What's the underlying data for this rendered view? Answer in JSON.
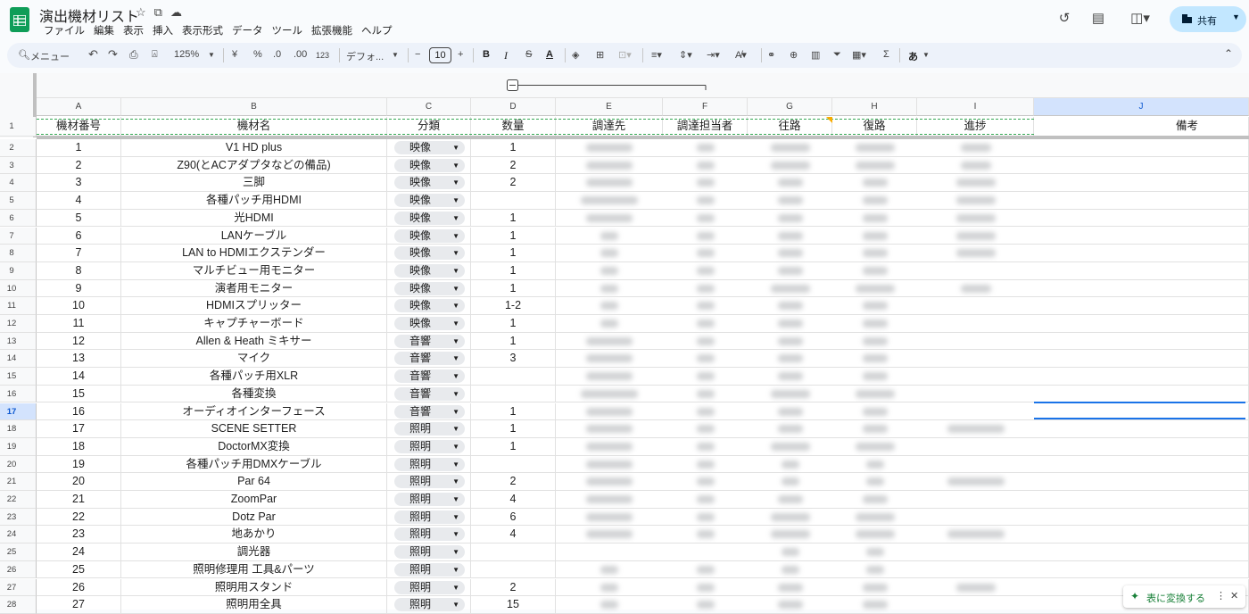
{
  "app": {
    "title": "演出機材リスト",
    "menu": [
      "ファイル",
      "編集",
      "表示",
      "挿入",
      "表示形式",
      "データ",
      "ツール",
      "拡張機能",
      "ヘルプ"
    ],
    "share_label": "共有"
  },
  "toolbar": {
    "search_label": "メニュー",
    "zoom": "125%",
    "currency": "¥",
    "percent": "%",
    "dec_decrease": ".0",
    "dec_increase": ".00",
    "number_format": "123",
    "font": "デフォ...",
    "font_size": "10",
    "minus": "−",
    "plus": "+",
    "bold": "B",
    "italic": "I",
    "strike": "S",
    "text_color": "A",
    "input_tool": "あ"
  },
  "columns": [
    {
      "letter": "A",
      "header": "機材番号"
    },
    {
      "letter": "B",
      "header": "機材名"
    },
    {
      "letter": "C",
      "header": "分類"
    },
    {
      "letter": "D",
      "header": "数量"
    },
    {
      "letter": "E",
      "header": "調達先"
    },
    {
      "letter": "F",
      "header": "調達担当者"
    },
    {
      "letter": "G",
      "header": "往路"
    },
    {
      "letter": "H",
      "header": "復路"
    },
    {
      "letter": "I",
      "header": "進捗"
    },
    {
      "letter": "J",
      "header": "備考"
    }
  ],
  "rows": [
    {
      "n": "2",
      "id": "1",
      "name": "V1 HD plus",
      "cat": "映像",
      "qty": "1"
    },
    {
      "n": "3",
      "id": "2",
      "name": "Z90(とACアダプタなどの備品)",
      "cat": "映像",
      "qty": "2"
    },
    {
      "n": "4",
      "id": "3",
      "name": "三脚",
      "cat": "映像",
      "qty": "2"
    },
    {
      "n": "5",
      "id": "4",
      "name": "各種パッチ用HDMI",
      "cat": "映像",
      "qty": ""
    },
    {
      "n": "6",
      "id": "5",
      "name": "光HDMI",
      "cat": "映像",
      "qty": "1"
    },
    {
      "n": "7",
      "id": "6",
      "name": "LANケーブル",
      "cat": "映像",
      "qty": "1"
    },
    {
      "n": "8",
      "id": "7",
      "name": "LAN to HDMIエクステンダー",
      "cat": "映像",
      "qty": "1"
    },
    {
      "n": "9",
      "id": "8",
      "name": "マルチビュー用モニター",
      "cat": "映像",
      "qty": "1"
    },
    {
      "n": "10",
      "id": "9",
      "name": "演者用モニター",
      "cat": "映像",
      "qty": "1"
    },
    {
      "n": "11",
      "id": "10",
      "name": "HDMIスプリッター",
      "cat": "映像",
      "qty": "1-2"
    },
    {
      "n": "12",
      "id": "11",
      "name": "キャプチャーボード",
      "cat": "映像",
      "qty": "1"
    },
    {
      "n": "13",
      "id": "12",
      "name": "Allen & Heath ミキサー",
      "cat": "音響",
      "qty": "1"
    },
    {
      "n": "14",
      "id": "13",
      "name": "マイク",
      "cat": "音響",
      "qty": "3"
    },
    {
      "n": "15",
      "id": "14",
      "name": "各種パッチ用XLR",
      "cat": "音響",
      "qty": ""
    },
    {
      "n": "16",
      "id": "15",
      "name": "各種変換",
      "cat": "音響",
      "qty": ""
    },
    {
      "n": "17",
      "id": "16",
      "name": "オーディオインターフェース",
      "cat": "音響",
      "qty": "1"
    },
    {
      "n": "18",
      "id": "17",
      "name": "SCENE SETTER",
      "cat": "照明",
      "qty": "1"
    },
    {
      "n": "19",
      "id": "18",
      "name": "DoctorMX変換",
      "cat": "照明",
      "qty": "1"
    },
    {
      "n": "20",
      "id": "19",
      "name": "各種パッチ用DMXケーブル",
      "cat": "照明",
      "qty": ""
    },
    {
      "n": "21",
      "id": "20",
      "name": "Par 64",
      "cat": "照明",
      "qty": "2"
    },
    {
      "n": "22",
      "id": "21",
      "name": "ZoomPar",
      "cat": "照明",
      "qty": "4"
    },
    {
      "n": "23",
      "id": "22",
      "name": "Dotz Par",
      "cat": "照明",
      "qty": "6"
    },
    {
      "n": "24",
      "id": "23",
      "name": "地あかり",
      "cat": "照明",
      "qty": "4"
    },
    {
      "n": "25",
      "id": "24",
      "name": "調光器",
      "cat": "照明",
      "qty": ""
    },
    {
      "n": "26",
      "id": "25",
      "name": "照明修理用 工具&パーツ",
      "cat": "照明",
      "qty": ""
    },
    {
      "n": "27",
      "id": "26",
      "name": "照明用スタンド",
      "cat": "照明",
      "qty": "2"
    },
    {
      "n": "28",
      "id": "27",
      "name": "照明用全具",
      "cat": "照明",
      "qty": "15"
    }
  ],
  "selected_row": "17",
  "convert_label": "表に変換する",
  "colors": {
    "accent": "#0b57d0",
    "share_bg": "#c2e7ff",
    "sheets_green": "#0f9d58"
  }
}
